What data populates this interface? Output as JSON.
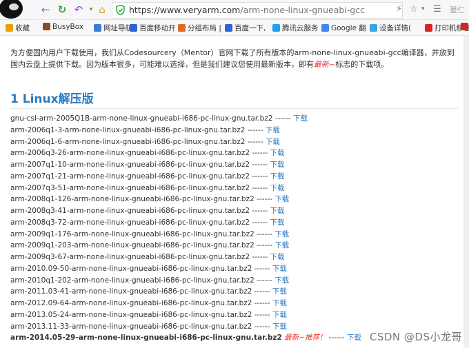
{
  "browser": {
    "url_domain": "https://www.veryarm.com",
    "url_path": "/arm-none-linux-gnueabi-gcc",
    "right_cut_label": "登仁"
  },
  "bookmarks": [
    {
      "label": "收藏",
      "color": "#e8a000",
      "icon": "star-icon"
    },
    {
      "label": "BusyBox",
      "color": "#8a4b2b",
      "icon": "folder-icon"
    },
    {
      "label": "网址导航",
      "color": "#3a7bd5",
      "icon": "globe-icon"
    },
    {
      "label": "百度移动开",
      "color": "#2f63d8",
      "icon": "paw-icon"
    },
    {
      "label": "分组布局 |",
      "color": "#d96b2b",
      "icon": "folder-icon"
    },
    {
      "label": "百度一下,",
      "color": "#2f63d8",
      "icon": "paw-icon"
    },
    {
      "label": "腾讯云服务",
      "color": "#1fa0e8",
      "icon": "cloud-icon"
    },
    {
      "label": "Google 翻",
      "color": "#4285f4",
      "icon": "google-icon"
    },
    {
      "label": "设备详情(",
      "color": "#3aa5e0",
      "icon": "cloud-icon"
    },
    {
      "label": "打印机移植",
      "color": "#d22",
      "icon": "c-icon"
    },
    {
      "label": "C",
      "color": "#d22",
      "icon": "c-icon"
    }
  ],
  "intro": {
    "text_before": "为方便国内用户下载使用，我们从Codesourcery（Mentor）官网下载了所有版本的arm-none-linux-gnueabi-gcc编译器，并放到国内云盘上提供下载。因为版本很多，可能难以选择，但是我们建议您使用最新版本，即有",
    "new_word": "最新~",
    "text_after": "标志的下载项。"
  },
  "heading": "1 Linux解压版",
  "separator": "------",
  "download_label": "下载",
  "files": [
    {
      "name": "gnu-csl-arm-2005Q1B-arm-none-linux-gnueabi-i686-pc-linux-gnu.tar.bz2"
    },
    {
      "name": "arm-2006q1-3-arm-none-linux-gnueabi-i686-pc-linux-gnu.tar.bz2"
    },
    {
      "name": "arm-2006q1-6-arm-none-linux-gnueabi-i686-pc-linux-gnu.tar.bz2"
    },
    {
      "name": "arm-2006q3-26-arm-none-linux-gnueabi-i686-pc-linux-gnu.tar.bz2"
    },
    {
      "name": "arm-2007q1-10-arm-none-linux-gnueabi-i686-pc-linux-gnu.tar.bz2"
    },
    {
      "name": "arm-2007q1-21-arm-none-linux-gnueabi-i686-pc-linux-gnu.tar.bz2"
    },
    {
      "name": "arm-2007q3-51-arm-none-linux-gnueabi-i686-pc-linux-gnu.tar.bz2"
    },
    {
      "name": "arm-2008q1-126-arm-none-linux-gnueabi-i686-pc-linux-gnu.tar.bz2"
    },
    {
      "name": "arm-2008q3-41-arm-none-linux-gnueabi-i686-pc-linux-gnu.tar.bz2"
    },
    {
      "name": "arm-2008q3-72-arm-none-linux-gnueabi-i686-pc-linux-gnu.tar.bz2"
    },
    {
      "name": "arm-2009q1-176-arm-none-linux-gnueabi-i686-pc-linux-gnu.tar.bz2"
    },
    {
      "name": "arm-2009q1-203-arm-none-linux-gnueabi-i686-pc-linux-gnu.tar.bz2"
    },
    {
      "name": "arm-2009q3-67-arm-none-linux-gnueabi-i686-pc-linux-gnu.tar.bz2"
    },
    {
      "name": "arm-2010.09-50-arm-none-linux-gnueabi-i686-pc-linux-gnu.tar.bz2"
    },
    {
      "name": "arm-2010q1-202-arm-none-linux-gnueabi-i686-pc-linux-gnu.tar.bz2"
    },
    {
      "name": "arm-2011.03-41-arm-none-linux-gnueabi-i686-pc-linux-gnu.tar.bz2"
    },
    {
      "name": "arm-2012.09-64-arm-none-linux-gnueabi-i686-pc-linux-gnu.tar.bz2"
    },
    {
      "name": "arm-2013.05-24-arm-none-linux-gnueabi-i686-pc-linux-gnu.tar.bz2"
    },
    {
      "name": "arm-2013.11-33-arm-none-linux-gnueabi-i686-pc-linux-gnu.tar.bz2"
    },
    {
      "name": "arm-2014.05-29-arm-none-linux-gnueabi-i686-pc-linux-gnu.tar.bz2",
      "bold": true,
      "tag": "最新~推荐！"
    }
  ],
  "watermark": "CSDN @DS小龙哥",
  "colors": {
    "link": "#2a7ac0",
    "accent_new": "#e33",
    "url_green": "#1a9e3b"
  }
}
